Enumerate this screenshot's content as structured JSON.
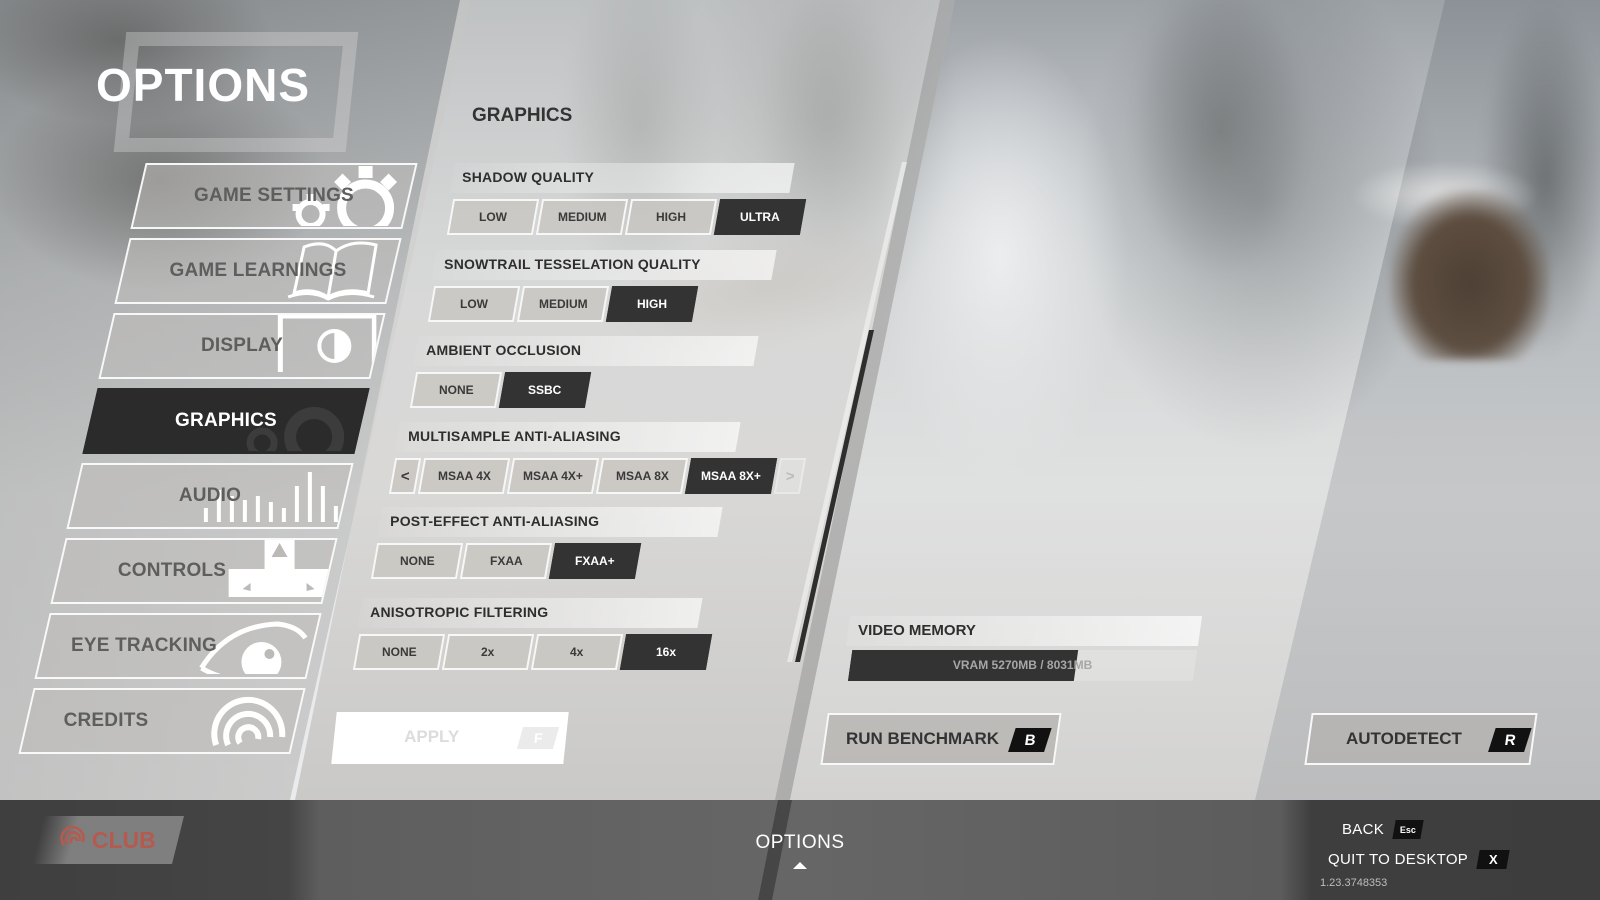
{
  "page": {
    "title": "OPTIONS"
  },
  "sidebar": {
    "items": [
      {
        "label": "GAME SETTINGS",
        "icon": "gears-icon",
        "active": false
      },
      {
        "label": "GAME LEARNINGS",
        "icon": "open-book-icon",
        "active": false
      },
      {
        "label": "DISPLAY",
        "icon": "monitor-contrast-icon",
        "active": false
      },
      {
        "label": "GRAPHICS",
        "icon": "gears-icon",
        "active": true
      },
      {
        "label": "AUDIO",
        "icon": "equalizer-bars-icon",
        "active": false
      },
      {
        "label": "CONTROLS",
        "icon": "dpad-icon",
        "active": false
      },
      {
        "label": "EYE TRACKING",
        "icon": "eye-icon",
        "active": false
      },
      {
        "label": "CREDITS",
        "icon": "ubisoft-swirl-icon",
        "active": false
      }
    ]
  },
  "graphics": {
    "section_title": "GRAPHICS",
    "settings": [
      {
        "label": "SHADOW QUALITY",
        "options": [
          "LOW",
          "MEDIUM",
          "HIGH",
          "ULTRA"
        ],
        "selected": "ULTRA"
      },
      {
        "label": "SNOWTRAIL TESSELATION QUALITY",
        "options": [
          "LOW",
          "MEDIUM",
          "HIGH"
        ],
        "selected": "HIGH"
      },
      {
        "label": "AMBIENT OCCLUSION",
        "options": [
          "NONE",
          "SSBC"
        ],
        "selected": "SSBC"
      },
      {
        "label": "MULTISAMPLE ANTI-ALIASING",
        "options": [
          "MSAA 4X",
          "MSAA 4X+",
          "MSAA 8X",
          "MSAA 8X+"
        ],
        "selected": "MSAA 8X+",
        "prev_arrow": "<",
        "next_arrow": ">"
      },
      {
        "label": "POST-EFFECT ANTI-ALIASING",
        "options": [
          "NONE",
          "FXAA",
          "FXAA+"
        ],
        "selected": "FXAA+"
      },
      {
        "label": "ANISOTROPIC FILTERING",
        "options": [
          "NONE",
          "2x",
          "4x",
          "16x"
        ],
        "selected": "16x"
      }
    ],
    "apply": {
      "label": "APPLY",
      "key": "F",
      "enabled": false
    }
  },
  "video_memory": {
    "label": "VIDEO MEMORY",
    "text": "VRAM 5270MB / 8031MB",
    "used_mb": 5270,
    "total_mb": 8031
  },
  "actions": {
    "benchmark": {
      "label": "RUN BENCHMARK",
      "key": "B"
    },
    "autodetect": {
      "label": "AUTODETECT",
      "key": "R"
    }
  },
  "bottom_bar": {
    "club_label": "CLUB",
    "title": "OPTIONS",
    "back": {
      "label": "BACK",
      "key": "Esc"
    },
    "quit": {
      "label": "QUIT TO DESKTOP",
      "key": "X"
    },
    "version": "1.23.3748353"
  },
  "colors": {
    "selected": "#333333",
    "club_red": "#b45a4f",
    "bottom_bar": "#5e5e5e"
  }
}
